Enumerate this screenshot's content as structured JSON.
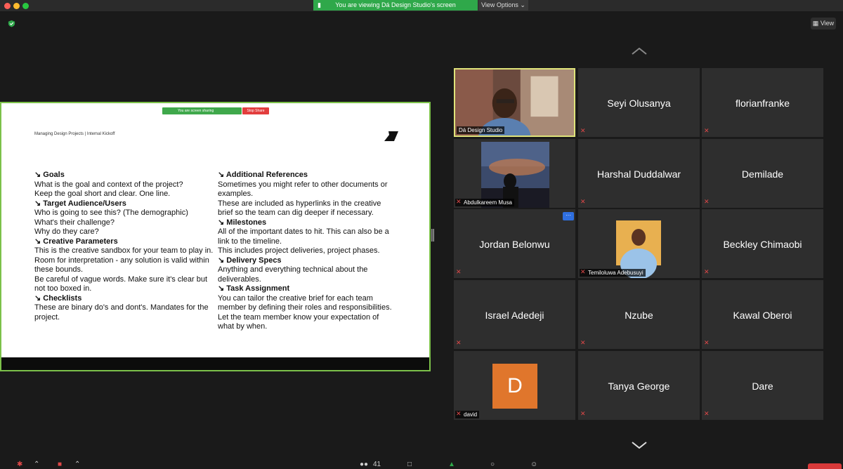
{
  "window": {
    "traffic_lights": [
      "close",
      "minimize",
      "maximize"
    ]
  },
  "banner": {
    "text": "You are viewing Dá Design Studio's screen",
    "view_options": "View Options"
  },
  "top_right": {
    "view_label": "View"
  },
  "slide": {
    "inner_share_text": "You are screen sharing",
    "inner_stop_text": "Stop Share",
    "header": "Managing Design Projects | Internal Kickoff",
    "left_sections": [
      {
        "title": "Goals",
        "lines": [
          "What is the goal and context of the project?",
          "Keep the goal short and clear. One line."
        ]
      },
      {
        "title": "Target Audience/Users",
        "lines": [
          "Who is going to see this? (The demographic)",
          "What's their challenge?",
          "Why do they care?"
        ]
      },
      {
        "title": "Creative Parameters",
        "lines": [
          "This is the creative sandbox for your team to play in. Room for interpretation - any solution is valid within these bounds.",
          "Be careful of vague words. Make sure it's clear but not too boxed in."
        ]
      },
      {
        "title": "Checklists",
        "lines": [
          "These are binary do's and dont's. Mandates for the project."
        ]
      }
    ],
    "right_sections": [
      {
        "title": "Additional References",
        "lines": [
          "Sometimes you might refer to other documents or examples.",
          "These are included as hyperlinks in the creative brief so the team can dig deeper if necessary."
        ]
      },
      {
        "title": "Milestones",
        "lines": [
          "All of the important dates to hit. This can also be a link to the timeline.",
          "This includes project deliveries, project phases."
        ]
      },
      {
        "title": "Delivery Specs",
        "lines": [
          "Anything and everything technical about the deliverables."
        ]
      },
      {
        "title": "Task Assignment",
        "lines": [
          "You can tailor the creative brief for each team member by defining their roles and responsibilities.",
          "Let the team member know your expectation of what by when."
        ]
      }
    ]
  },
  "participants": [
    {
      "name": "Dá Design Studio",
      "type": "video",
      "active": true
    },
    {
      "name": "Seyi Olusanya",
      "type": "name",
      "muted": true
    },
    {
      "name": "florianfranke",
      "type": "name",
      "muted": true
    },
    {
      "name": "Abdulkareem Musa",
      "type": "photo",
      "muted": true
    },
    {
      "name": "Harshal Duddalwar",
      "type": "name",
      "muted": true
    },
    {
      "name": "Demilade",
      "type": "name",
      "muted": true
    },
    {
      "name": "Jordan Belonwu",
      "type": "name",
      "muted": true,
      "more_menu": "···"
    },
    {
      "name": "Temiloluwa Adebusuyi",
      "type": "photo",
      "muted": true
    },
    {
      "name": "Beckley Chimaobi",
      "type": "name",
      "muted": true
    },
    {
      "name": "Israel Adedeji",
      "type": "name",
      "muted": true
    },
    {
      "name": "Nzube",
      "type": "name",
      "muted": true
    },
    {
      "name": "Kawal Oberoi",
      "type": "name",
      "muted": true
    },
    {
      "name": "david",
      "type": "initial",
      "initial": "D",
      "muted": true
    },
    {
      "name": "Tanya George",
      "type": "name",
      "muted": true
    },
    {
      "name": "Dare",
      "type": "name",
      "muted": true
    }
  ],
  "toolbar": {
    "participants_count": "41"
  },
  "colors": {
    "share_green": "#2fa84a",
    "active_border": "#dfe37a",
    "tile_bg": "#2e2e2e",
    "avatar_orange": "#e0762c",
    "mute_red": "#e04848"
  }
}
